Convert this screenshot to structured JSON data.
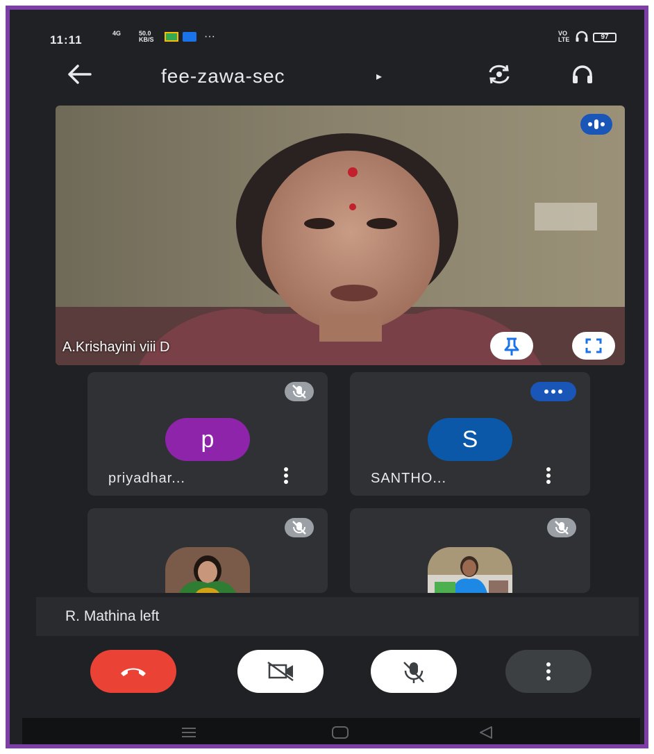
{
  "status_bar": {
    "time": "11:11",
    "signal": "4G",
    "net_speed_value": "50.0",
    "net_speed_unit": "KB/S",
    "more": "···",
    "volte_top": "VO",
    "volte_bottom": "LTE",
    "battery": "97"
  },
  "meeting": {
    "code": "fee-zawa-sec",
    "code_arrow": "▸"
  },
  "main_participant": {
    "name": "A.Krishayini viii D"
  },
  "participants": [
    {
      "name": "priyadhar...",
      "initial": "p",
      "avatar_color": "#8e24aa",
      "muted": true
    },
    {
      "name": "SANTHO...",
      "initial": "S",
      "avatar_color": "#0b57a8",
      "muted": false
    },
    {
      "name": "",
      "muted": true,
      "has_photo": true
    },
    {
      "name": "",
      "muted": true,
      "has_photo": true
    }
  ],
  "notification": {
    "text": "R. Mathina left"
  },
  "controls": {
    "end_call_color": "#ea4335",
    "icons": [
      "end-call-icon",
      "camera-off-icon",
      "mic-off-icon",
      "more-vert-icon"
    ]
  },
  "colors": {
    "frame_border": "#7b3fa6",
    "background": "#202124",
    "tile": "#2f3135",
    "accent_blue": "#1a56b8"
  }
}
